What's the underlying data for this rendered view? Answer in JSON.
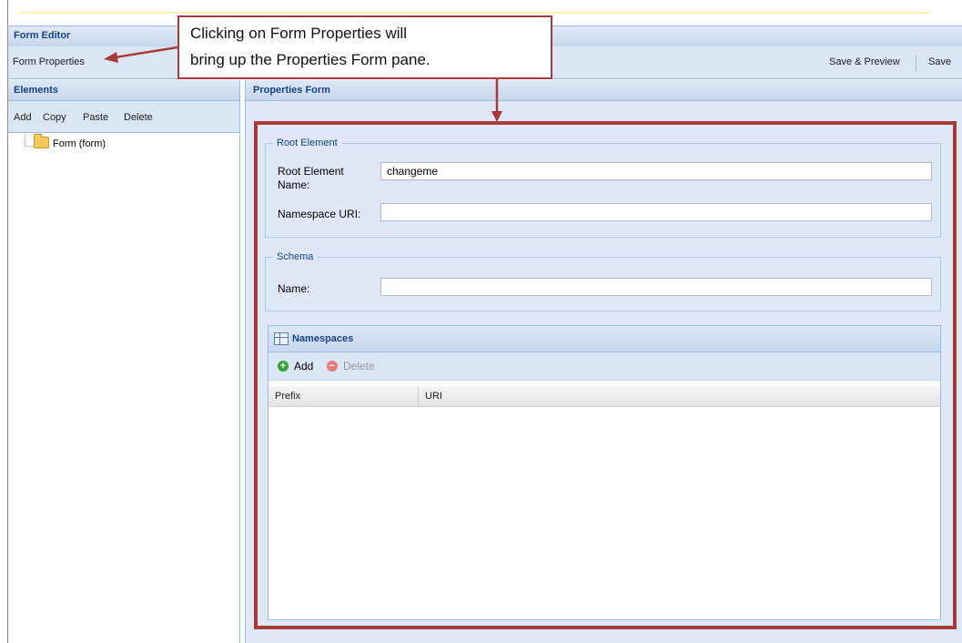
{
  "form_editor": {
    "title": "Form Editor",
    "toolbar": {
      "form_properties": "Form Properties",
      "save_preview": "Save & Preview",
      "save": "Save"
    }
  },
  "elements_panel": {
    "title": "Elements",
    "tools": [
      "Add",
      "Copy",
      "Paste",
      "Delete"
    ],
    "tree": {
      "node_label": "Form (form)"
    }
  },
  "properties_panel": {
    "title": "Properties Form",
    "root_element": {
      "legend": "Root Element",
      "name_label_line1": "Root Element",
      "name_label_line2": "Name:",
      "name_value": "changeme",
      "namespace_label": "Namespace URI:",
      "namespace_value": ""
    },
    "schema": {
      "legend": "Schema",
      "name_label": "Name:",
      "name_value": ""
    },
    "namespaces": {
      "title": "Namespaces",
      "add_label": "Add",
      "delete_label": "Delete",
      "columns": [
        "Prefix",
        "URI"
      ]
    }
  },
  "callout": {
    "line1": "Clicking on Form Properties will",
    "line2": "bring up the Properties Form pane."
  },
  "colors": {
    "header_text": "#15428b",
    "annotation_red": "#a83a3a",
    "add_green": "#3aa23a",
    "delete_red": "#e87a7a"
  },
  "icons": [
    "folder-icon",
    "grid-icon",
    "add-icon",
    "delete-icon"
  ]
}
